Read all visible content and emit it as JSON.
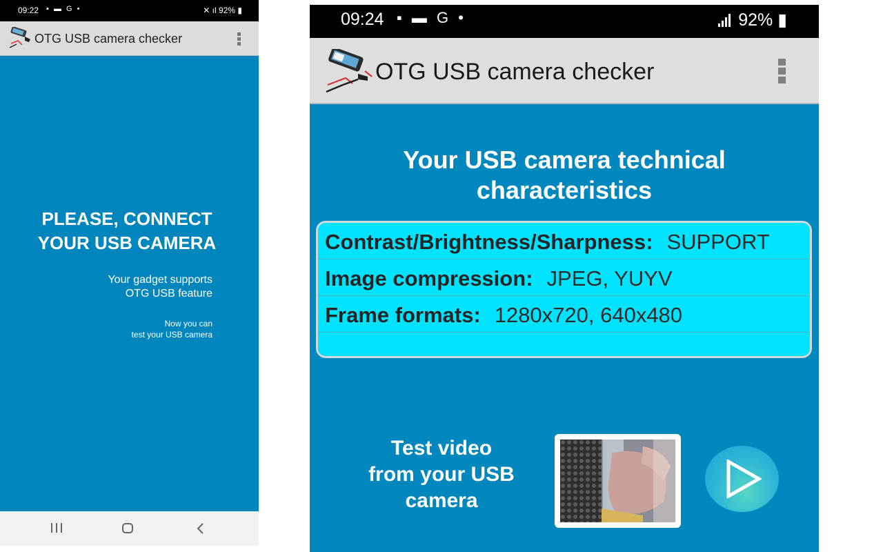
{
  "left": {
    "status": {
      "time": "09:22",
      "icons_left": "▪ ▬ G •",
      "battery": "92%"
    },
    "app": {
      "title": "OTG USB camera checker"
    },
    "main": {
      "connect_line1": "PLEASE, CONNECT",
      "connect_line2": "YOUR USB CAMERA",
      "supports_line1": "Your gadget supports",
      "supports_line2": "OTG USB feature",
      "now_line1": "Now you can",
      "now_line2": "test your USB camera"
    },
    "navbar": {
      "recents": "recents-icon",
      "home": "home-icon",
      "back": "back-icon"
    }
  },
  "right": {
    "status": {
      "time": "09:24",
      "icons_left": "▪ ▬ G •",
      "battery": "92%"
    },
    "app": {
      "title": "OTG USB camera checker"
    },
    "heading_line1": "Your USB camera technical",
    "heading_line2": "characteristics",
    "characteristics": [
      {
        "key": "Contrast/Brightness/Sharpness:",
        "value": "SUPPORT"
      },
      {
        "key": "Image compression:",
        "value": "JPEG, YUYV"
      },
      {
        "key": "Frame formats:",
        "value": "1280x720, 640x480"
      }
    ],
    "test_label_line1": "Test video",
    "test_label_line2": "from your USB",
    "test_label_line3": "camera"
  },
  "colors": {
    "background_blue": "#0086bd",
    "table_cyan": "#00e3ff",
    "appbar_grey": "#dcdcdc"
  }
}
